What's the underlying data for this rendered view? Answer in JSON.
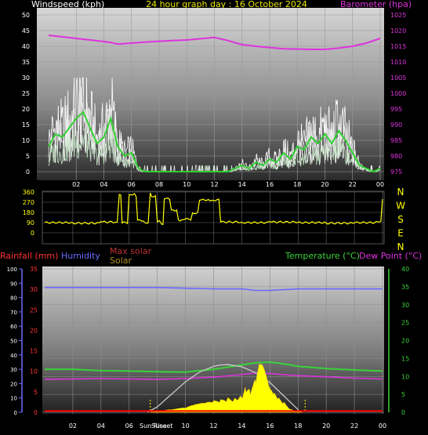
{
  "header": {
    "title": "24 hour graph day : 16 October 2024",
    "left_label": "Windspeed (kph)",
    "right_label": "Barometer (hpa)"
  },
  "colors": {
    "title": "#e8e800",
    "wind": "#ffffff",
    "wind_avg": "#2fd12f",
    "gust": "#ffffff",
    "barometer": "#dd33dd",
    "direction": "#ffff00",
    "rainfall": "#ff3333",
    "humidity": "#6a6aff",
    "temperature": "#3ad23a",
    "dewpoint": "#dd33dd",
    "solar": "#ffff00",
    "max_solar": "#c8c8c8",
    "rain_bar": "#ff0000"
  },
  "legend": {
    "rainfall": "Rainfall (mm)",
    "humidity": "Humidity",
    "max_solar": "Max solar",
    "solar": "Solar",
    "temperature": "Temperature (°C)",
    "dewpoint": "Dew Point (°C)",
    "sunrise": "Sun Rise",
    "sunset": "Sunset"
  },
  "compass": [
    "N",
    "W",
    "S",
    "E",
    "N"
  ],
  "chart_data": [
    {
      "type": "line",
      "title": "24 hour graph day : 16 October 2024",
      "x_ticks": [
        "02",
        "04",
        "06",
        "08",
        "10",
        "12",
        "14",
        "16",
        "18",
        "20",
        "22",
        "00"
      ],
      "y_left": {
        "label": "Windspeed (kph)",
        "ticks": [
          0,
          5,
          10,
          15,
          20,
          25,
          30,
          35,
          40,
          45,
          50
        ],
        "range": [
          0,
          50
        ]
      },
      "y_right": {
        "label": "Barometer (hpa)",
        "ticks": [
          975,
          980,
          985,
          990,
          995,
          1000,
          1005,
          1010,
          1015,
          1020,
          1025
        ],
        "range": [
          975,
          1025
        ]
      },
      "series": [
        {
          "name": "Barometer (hpa)",
          "axis": "right",
          "x": [
            0,
            1,
            2,
            3,
            4,
            4.5,
            5,
            6,
            7,
            8,
            9,
            10,
            11,
            12,
            13,
            14,
            15,
            16,
            17,
            18,
            19,
            20,
            21,
            22,
            23,
            24
          ],
          "y": [
            1018.5,
            1018,
            1017.5,
            1017,
            1016.5,
            1016.2,
            1015.7,
            1016,
            1016.3,
            1016.6,
            1016.8,
            1017,
            1017.4,
            1017.8,
            1016.8,
            1015.5,
            1015,
            1014.6,
            1014.2,
            1014.1,
            1014,
            1014,
            1014.4,
            1015,
            1016,
            1017.5
          ]
        },
        {
          "name": "Windspeed avg",
          "axis": "left",
          "x": [
            0,
            0.5,
            1,
            1.5,
            2,
            2.5,
            3,
            3.5,
            4,
            4.5,
            5,
            5.5,
            6,
            6.5,
            7,
            12,
            13,
            13.5,
            14,
            14.5,
            15,
            15.5,
            16,
            16.5,
            17,
            17.5,
            18,
            18.5,
            19,
            19.5,
            20,
            20.5,
            21,
            21.5,
            22,
            22.5,
            23,
            23.5,
            24
          ],
          "y": [
            8,
            12,
            11,
            14,
            17,
            19,
            14,
            9,
            11,
            17,
            8,
            5,
            6,
            1,
            0,
            0,
            0,
            1,
            2,
            1,
            3,
            2,
            4,
            3,
            6,
            4,
            8,
            7,
            11,
            9,
            12,
            9,
            13,
            10,
            6,
            2,
            1,
            0,
            1
          ]
        }
      ]
    },
    {
      "type": "line",
      "title": "",
      "y_ticks": [
        0,
        90,
        180,
        270,
        360
      ],
      "range": [
        0,
        360
      ],
      "series": [
        {
          "name": "Wind direction",
          "x": [
            0,
            2,
            4,
            5,
            5.3,
            5.5,
            6,
            6.5,
            6.6,
            7,
            7.2,
            7.5,
            7.6,
            8,
            8.3,
            8.5,
            9,
            9.5,
            10,
            10.5,
            11,
            11.5,
            12,
            12.5,
            14,
            16,
            18,
            20,
            22,
            23.5,
            24
          ],
          "y": [
            90,
            85,
            95,
            90,
            340,
            90,
            340,
            320,
            110,
            100,
            80,
            350,
            320,
            100,
            80,
            300,
            200,
            110,
            120,
            175,
            290,
            290,
            290,
            95,
            90,
            95,
            90,
            85,
            90,
            100,
            300
          ]
        }
      ]
    },
    {
      "type": "line",
      "title": "",
      "y_left_outer": {
        "label": "Humidity",
        "ticks": [
          0,
          10,
          20,
          30,
          40,
          50,
          60,
          70,
          80,
          90,
          100
        ],
        "range": [
          0,
          100
        ]
      },
      "y_left_inner": {
        "label": "Rainfall (mm)",
        "ticks": [
          0,
          5,
          10,
          15,
          20,
          25,
          30,
          35
        ],
        "range": [
          0,
          35
        ]
      },
      "y_right": {
        "label": "Temperature (°C)",
        "ticks": [
          0,
          5,
          10,
          15,
          20,
          25,
          30,
          35,
          40
        ],
        "range": [
          0,
          40
        ]
      },
      "x_ticks": [
        "02",
        "04",
        "06",
        "08",
        "10",
        "12",
        "14",
        "16",
        "18",
        "20",
        "22",
        "00"
      ],
      "series": [
        {
          "name": "Humidity",
          "axis": "left_outer",
          "x": [
            0,
            4,
            8,
            12,
            14,
            15,
            16,
            18,
            20,
            22,
            24
          ],
          "y": [
            87,
            87,
            87,
            86,
            86,
            85,
            85,
            86,
            86,
            86,
            86
          ]
        },
        {
          "name": "Temperature (°C)",
          "axis": "right",
          "x": [
            0,
            2,
            4,
            6,
            8,
            10,
            12,
            13,
            14,
            15,
            16,
            17,
            18,
            19,
            20,
            22,
            24
          ],
          "y": [
            12,
            12,
            11.6,
            11.5,
            11.3,
            11.2,
            12,
            12.6,
            13.2,
            13.8,
            14,
            13.5,
            12.8,
            12.5,
            12.2,
            11.8,
            11.5
          ]
        },
        {
          "name": "Dew Point (°C)",
          "axis": "right",
          "x": [
            0,
            2,
            4,
            6,
            8,
            10,
            12,
            14,
            15,
            16,
            17,
            18,
            20,
            22,
            24
          ],
          "y": [
            9.2,
            9.3,
            9.4,
            9.3,
            9.2,
            9.4,
            9.8,
            10.5,
            11,
            10.8,
            10.5,
            10.2,
            9.9,
            9.5,
            9.3
          ]
        },
        {
          "name": "Max solar",
          "axis": "right",
          "x": [
            7.3,
            8,
            9,
            10,
            11,
            12,
            12.5,
            13,
            14,
            15,
            16,
            17,
            18.2
          ],
          "y": [
            0,
            1.5,
            5,
            8.5,
            11.2,
            12.8,
            13.2,
            13.3,
            12.7,
            11,
            8.3,
            4.5,
            0
          ]
        },
        {
          "name": "Solar",
          "axis": "right",
          "x": [
            7.5,
            8,
            9,
            10,
            10.5,
            11,
            11.5,
            12,
            12.5,
            13,
            13.5,
            14,
            14.3,
            14.6,
            15,
            15.3,
            15.6,
            16,
            16.3,
            16.6,
            17,
            17.5,
            18,
            18.3
          ],
          "y": [
            0,
            0.3,
            0.8,
            1.2,
            1.8,
            2.2,
            2.5,
            3,
            3.5,
            4.5,
            5,
            6,
            8,
            6,
            9,
            13,
            11,
            6,
            5,
            4,
            3,
            1,
            0.3,
            0
          ]
        },
        {
          "name": "Rainfall (mm)",
          "axis": "left_inner",
          "x": [
            0,
            24
          ],
          "y": [
            0.3,
            0.3
          ]
        }
      ],
      "sunrise_hour": 7.5,
      "sunset_hour": 18.5
    }
  ]
}
